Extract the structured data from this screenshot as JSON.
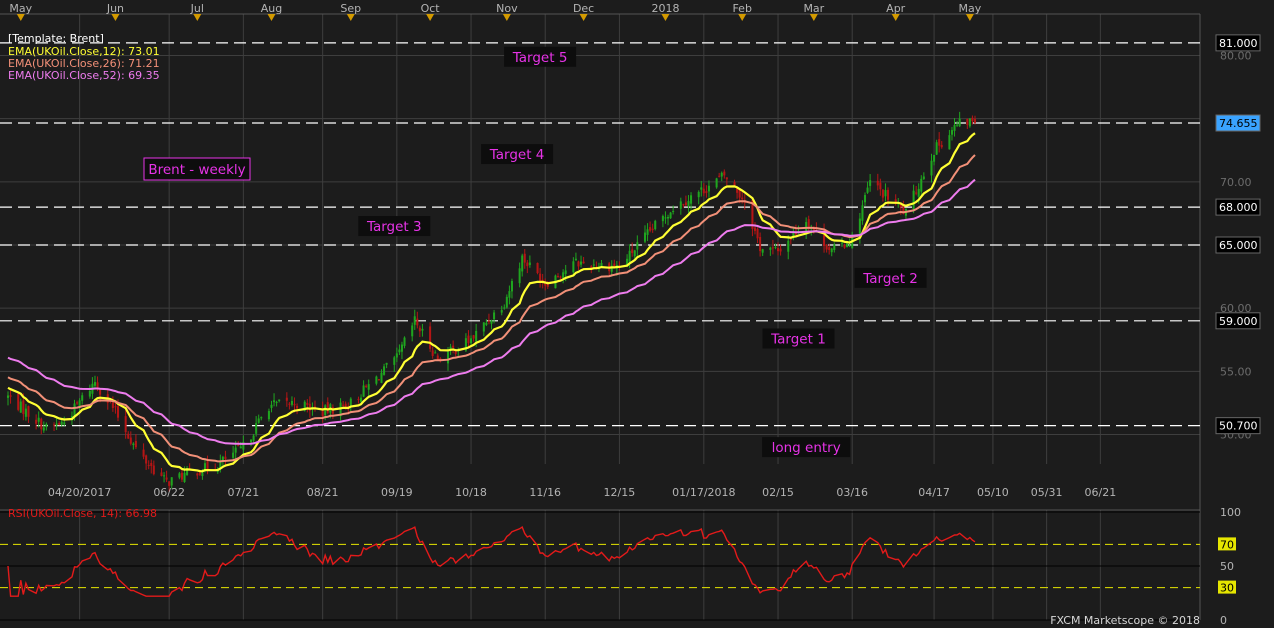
{
  "colors": {
    "background": "#1c1c1c",
    "grid": "#3e3e3e",
    "up_candle": "#1fa51f",
    "down_candle": "#b51515",
    "ema12": "#ffff33",
    "ema26": "#f29078",
    "ema52": "#ee7cee",
    "rsi": "#e31a1a",
    "annotation": "#e633e6",
    "level_line": "#ffffff",
    "rsi_level": "#e6e600",
    "last_price_tag": "#3aa3ff",
    "axis_text": "#b4b4b4"
  },
  "chart_data": [
    {
      "type": "candlestick",
      "title": "[Template: Brent]",
      "frequency_label": "Brent - weekly",
      "ylim": [
        47,
        83
      ],
      "yticks": [
        50,
        55,
        60,
        65,
        70,
        75,
        80
      ],
      "ytick_labels": [
        "50.00",
        "55.00",
        "60.00",
        "65.00",
        "70.00",
        "75.00",
        "80.00"
      ],
      "top_months": [
        "May",
        "Jun",
        "Jul",
        "Aug",
        "Sep",
        "Oct",
        "Nov",
        "Dec",
        "2018",
        "Feb",
        "Mar",
        "Apr",
        "May"
      ],
      "date_labels": [
        "04/20/2017",
        "06/22",
        "07/21",
        "08/21",
        "09/19",
        "10/18",
        "11/16",
        "12/15",
        "01/17/2018",
        "02/15",
        "03/16",
        "04/17",
        "05/10",
        "05/31",
        "06/21"
      ],
      "levels": [
        {
          "value": 81.0,
          "label": "81.000"
        },
        {
          "value": 74.655,
          "label": "74.655",
          "last_price": true
        },
        {
          "value": 68.0,
          "label": "68.000"
        },
        {
          "value": 65.0,
          "label": "65.000"
        },
        {
          "value": 59.0,
          "label": "59.000"
        },
        {
          "value": 50.7,
          "label": "50.700"
        }
      ],
      "annotations": [
        {
          "text": "Target 5",
          "value": 79.9
        },
        {
          "text": "Target 4",
          "value": 72.2
        },
        {
          "text": "Target 3",
          "value": 66.5
        },
        {
          "text": "Target 2",
          "value": 62.4
        },
        {
          "text": "Target 1",
          "value": 57.6
        },
        {
          "text": "long entry",
          "value": 49.0
        }
      ],
      "legend": [
        {
          "name": "EMA(UKOil.Close,12)",
          "value": "73.01"
        },
        {
          "name": "EMA(UKOil.Close,26)",
          "value": "71.21"
        },
        {
          "name": "EMA(UKOil.Close,52)",
          "value": "69.35"
        }
      ],
      "ohlc_anchors": {
        "description": "Daily Brent closes, 04/20/2017 to 05/2018",
        "dates": [
          "2017-04-20",
          "2017-05-05",
          "2017-05-12",
          "2017-05-24",
          "2017-06-01",
          "2017-06-10",
          "2017-06-21",
          "2017-06-30",
          "2017-07-10",
          "2017-07-21",
          "2017-07-31",
          "2017-08-10",
          "2017-08-21",
          "2017-09-01",
          "2017-09-19",
          "2017-09-26",
          "2017-10-05",
          "2017-10-18",
          "2017-10-31",
          "2017-11-07",
          "2017-11-16",
          "2017-11-28",
          "2017-12-15",
          "2017-12-28",
          "2018-01-05",
          "2018-01-17",
          "2018-01-25",
          "2018-02-02",
          "2018-02-08",
          "2018-02-15",
          "2018-02-26",
          "2018-03-08",
          "2018-03-16",
          "2018-03-23",
          "2018-04-06",
          "2018-04-17",
          "2018-04-26",
          "2018-05-03"
        ],
        "closes": [
          53.0,
          50.5,
          51.0,
          54.2,
          51.8,
          48.5,
          46.2,
          47.0,
          47.5,
          49.0,
          52.3,
          52.5,
          51.8,
          52.5,
          56.0,
          59.0,
          56.0,
          57.5,
          60.5,
          64.0,
          62.0,
          63.6,
          63.3,
          66.3,
          68.0,
          69.4,
          70.5,
          68.5,
          64.8,
          64.5,
          67.0,
          64.5,
          65.5,
          70.0,
          67.5,
          72.5,
          74.5,
          74.9
        ]
      }
    },
    {
      "type": "line",
      "title": "RSI(UKOil.Close, 14)",
      "title_value": "66.98",
      "ylim": [
        0,
        100
      ],
      "levels": [
        {
          "value": 100,
          "label": "100"
        },
        {
          "value": 70,
          "label": "70",
          "highlight": true
        },
        {
          "value": 50,
          "label": "50"
        },
        {
          "value": 30,
          "label": "30",
          "highlight": true
        },
        {
          "value": 0,
          "label": "0"
        }
      ]
    }
  ],
  "footer": "FXCM Marketscope © 2018"
}
